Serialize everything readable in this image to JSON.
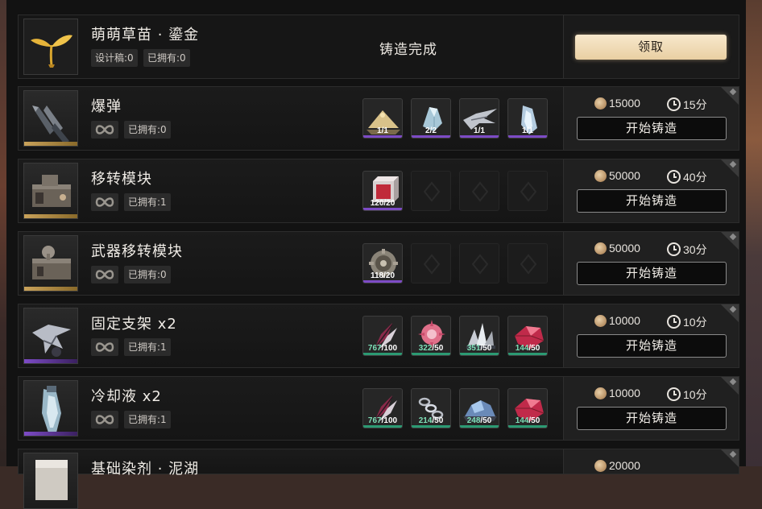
{
  "top_item": {
    "name": "萌萌草苗 · 鎏金",
    "design_chip": "设计稿:0",
    "owned_chip": "已拥有:0",
    "status": "铸造完成",
    "claim_label": "领取"
  },
  "colors": {
    "gold": "#c9a25a",
    "purple": "#7d4bc6",
    "green": "#2c9a73",
    "accent_claim": "#f0dcb8"
  },
  "rows": [
    {
      "name": "爆弹",
      "owned": "已拥有:0",
      "rarity": "gold",
      "icon": "bomb-shells-icon",
      "materials": [
        {
          "count": "1/1",
          "bar": "purple",
          "icon": "sand-pile-icon"
        },
        {
          "count": "2/2",
          "bar": "purple",
          "icon": "crystal-icon"
        },
        {
          "count": "1/1",
          "bar": "purple",
          "icon": "wing-blade-icon"
        },
        {
          "count": "1/1",
          "bar": "purple",
          "icon": "ice-shard-icon"
        }
      ],
      "coins": "15000",
      "time": "15分",
      "button": "开始铸造"
    },
    {
      "name": "移转模块",
      "owned": "已拥有:1",
      "rarity": "gold",
      "icon": "module-device-icon",
      "materials": [
        {
          "count": "120/20",
          "bar": "purple",
          "icon": "red-cube-icon"
        }
      ],
      "empty_slots": 3,
      "coins": "50000",
      "time": "40分",
      "button": "开始铸造"
    },
    {
      "name": "武器移转模块",
      "owned": "已拥有:0",
      "rarity": "gold",
      "icon": "weapon-module-icon",
      "materials": [
        {
          "count": "118/20",
          "bar": "purple",
          "icon": "gear-sphere-icon"
        }
      ],
      "empty_slots": 3,
      "coins": "50000",
      "time": "30分",
      "button": "开始铸造"
    },
    {
      "name": "固定支架 x2",
      "owned": "已拥有:1",
      "rarity": "purple",
      "icon": "bracket-icon",
      "materials": [
        {
          "count": "767/100",
          "bar": "green",
          "icon": "feather-icon"
        },
        {
          "count": "322/50",
          "bar": "green",
          "icon": "pink-flower-icon"
        },
        {
          "count": "351/50",
          "bar": "green",
          "icon": "crystal-cluster-icon"
        },
        {
          "count": "144/50",
          "bar": "green",
          "icon": "red-gem-icon"
        }
      ],
      "coins": "10000",
      "time": "10分",
      "button": "开始铸造"
    },
    {
      "name": "冷却液 x2",
      "owned": "已拥有:1",
      "rarity": "purple",
      "icon": "coolant-icon",
      "materials": [
        {
          "count": "767/100",
          "bar": "green",
          "icon": "feather-icon"
        },
        {
          "count": "214/50",
          "bar": "green",
          "icon": "chain-icon"
        },
        {
          "count": "248/50",
          "bar": "green",
          "icon": "blue-ore-icon"
        },
        {
          "count": "144/50",
          "bar": "green",
          "icon": "red-gem-icon"
        }
      ],
      "coins": "10000",
      "time": "10分",
      "button": "开始铸造"
    },
    {
      "name": "基础染剂 · 泥湖",
      "coins": "20000",
      "partial": true
    }
  ]
}
